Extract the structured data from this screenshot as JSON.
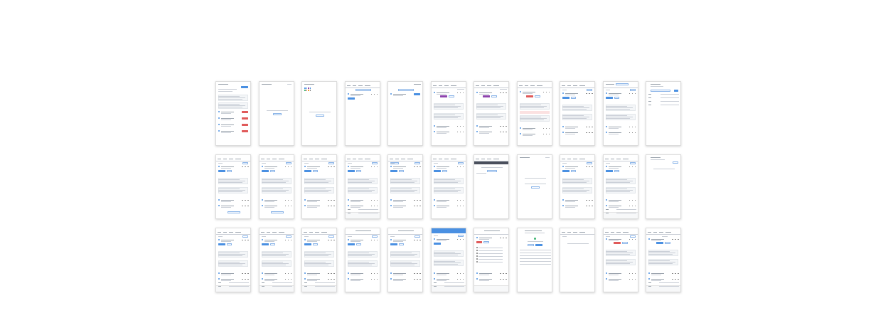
{
  "grid": {
    "rows": 3,
    "cols": 11
  },
  "cards": [
    {
      "variant": "list-red"
    },
    {
      "variant": "empty-center"
    },
    {
      "variant": "color-dots"
    },
    {
      "variant": "tabs-simple"
    },
    {
      "variant": "search-simple"
    },
    {
      "variant": "tabs-purple"
    },
    {
      "variant": "tabs-purple-notes"
    },
    {
      "variant": "tabs-red-notes"
    },
    {
      "variant": "tabs-blue-notes"
    },
    {
      "variant": "header-notes"
    },
    {
      "variant": "header-list"
    },
    {
      "variant": "tabs-blue-notes-more"
    },
    {
      "variant": "tabs-blue-notes-more"
    },
    {
      "variant": "tabs-blue-notes"
    },
    {
      "variant": "tabs-blue-notes-foot"
    },
    {
      "variant": "tabs-search-notes"
    },
    {
      "variant": "tabs-blue-notes"
    },
    {
      "variant": "dark-bar"
    },
    {
      "variant": "empty-center-2"
    },
    {
      "variant": "tabs-blue-notes"
    },
    {
      "variant": "tabs-blue-notes-foot"
    },
    {
      "variant": "header-empty"
    },
    {
      "variant": "tabs-blue-notes-foot"
    },
    {
      "variant": "tabs-blue-notes-foot"
    },
    {
      "variant": "tabs-blue-notes-foot"
    },
    {
      "variant": "title-notes"
    },
    {
      "variant": "title-notes"
    },
    {
      "variant": "blue-header"
    },
    {
      "variant": "title-red-list"
    },
    {
      "variant": "title-green"
    },
    {
      "variant": "tabs-empty"
    },
    {
      "variant": "tabs-red-center"
    },
    {
      "variant": "tabs-centered"
    }
  ]
}
